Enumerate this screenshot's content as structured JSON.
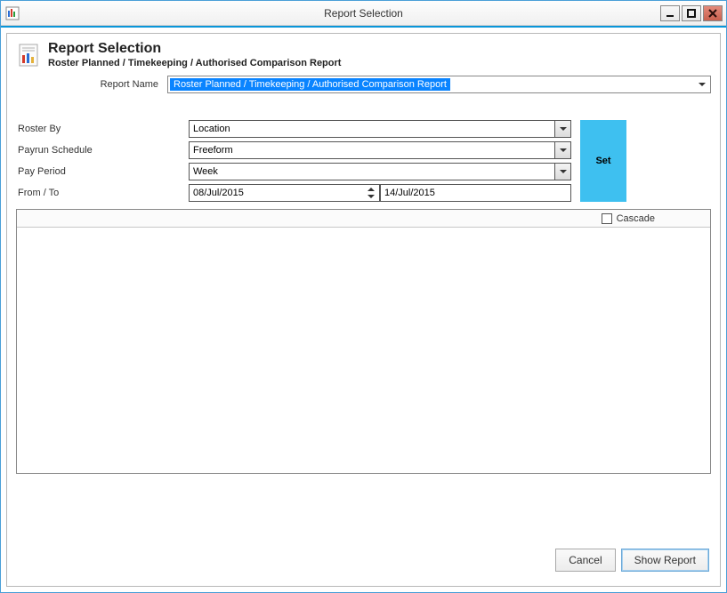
{
  "window": {
    "title": "Report Selection",
    "minimize_symbol": "—",
    "maximize_symbol": "□",
    "close_symbol": "✕"
  },
  "header": {
    "title": "Report Selection",
    "subtitle": "Roster Planned / Timekeeping / Authorised Comparison Report"
  },
  "report_name": {
    "label": "Report Name",
    "value": "Roster Planned / Timekeeping / Authorised Comparison Report"
  },
  "filters": {
    "roster_by": {
      "label": "Roster By",
      "value": "Location"
    },
    "payrun_schedule": {
      "label": "Payrun Schedule",
      "value": "Freeform"
    },
    "pay_period": {
      "label": "Pay Period",
      "value": "Week"
    },
    "from_to": {
      "label": "From / To",
      "from": "08/Jul/2015",
      "to": "14/Jul/2015"
    },
    "set_label": "Set"
  },
  "results": {
    "cascade_label": "Cascade",
    "cascade_checked": false
  },
  "buttons": {
    "cancel": "Cancel",
    "show_report": "Show Report"
  },
  "colors": {
    "accent": "#0a96d9",
    "set_button": "#3ec0f0",
    "selection_bg": "#0a84ff"
  }
}
